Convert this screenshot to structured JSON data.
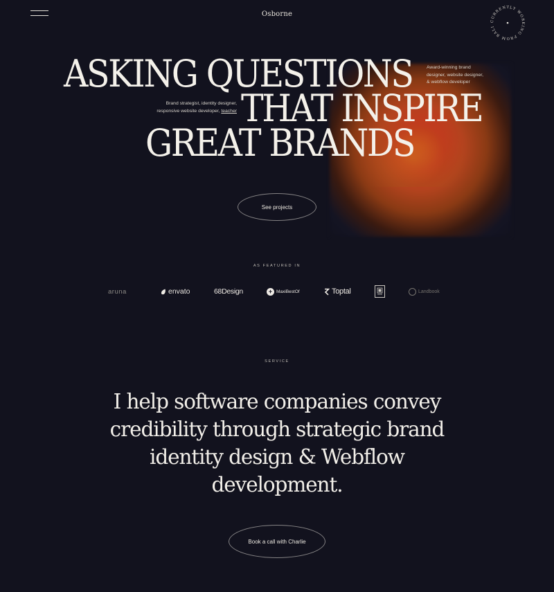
{
  "header": {
    "logo": "Osborne",
    "badge_text": "CURRENTLY WORKING FROM BALI ·"
  },
  "hero": {
    "headline_line1": "ASKING QUESTIONS",
    "headline_line2": "THAT INSPIRE",
    "headline_line3": "GREAT BRANDS",
    "note_right_1": "Award-winning brand",
    "note_right_2": "designer, website designer,",
    "note_right_3": "& webflow developer",
    "note_left_1": "Brand strategist, identity designer,",
    "note_left_2": "responsive website developer,",
    "note_left_link": "teacher",
    "cta_label": "See projects"
  },
  "featured": {
    "label": "AS FEATURED IN",
    "logos": [
      "aruna",
      "envato",
      "68Design",
      "MaxiBestOf",
      "Toptal",
      "Landbook"
    ]
  },
  "service": {
    "label": "SERVICE",
    "statement": "I help software companies convey credibility through strategic brand identity design & Webflow development.",
    "cta_label": "Book a call with Charlie"
  },
  "colors": {
    "background": "#12121e",
    "text": "#f2efe9",
    "orb_core": "#d4421e",
    "orb_edge": "#b07a1e"
  }
}
